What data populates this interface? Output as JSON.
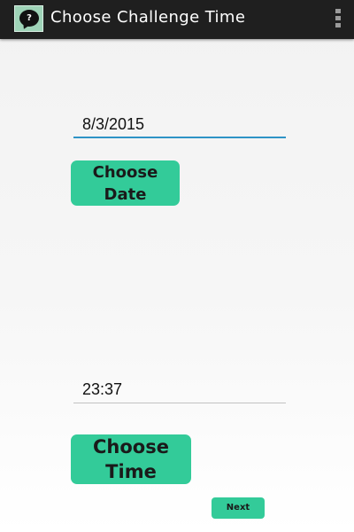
{
  "action_bar": {
    "icon_glyph": "?",
    "title": "Choose Challenge Time",
    "menu_icon": "overflow-menu-icon"
  },
  "date_section": {
    "value": "8/3/2015",
    "button_label": "Choose\nDate"
  },
  "time_section": {
    "value": "23:37",
    "button_label": "Choose\nTime"
  },
  "footer": {
    "next_label": "Next"
  },
  "colors": {
    "action_bar_bg": "#1f1f1f",
    "accent_button": "#33cb99",
    "focused_underline": "#2e93c6",
    "app_icon_bg": "#9ed3b7"
  }
}
